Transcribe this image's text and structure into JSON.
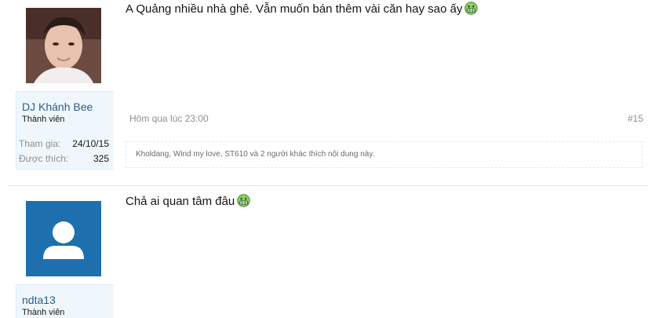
{
  "posts": [
    {
      "username": "DJ Khánh Bee",
      "user_title": "Thành viên",
      "joined_label": "Tham gia:",
      "joined_value": "24/10/15",
      "likes_label": "Được thích:",
      "likes_value": "325",
      "message": "A Quảng nhiều nhà ghê. Vẫn muốn bán thêm vài căn hay sao ấy",
      "date": "Hôm qua lúc 23:00",
      "post_number": "#15",
      "liked_by": "Kholdang, Wind my love, ST610 và 2 người khác thích nội dung này."
    },
    {
      "username": "ndta13",
      "user_title": "Thành viên",
      "message": "Chả ai quan tâm đâu"
    }
  ],
  "colors": {
    "link": "#2b5d8c",
    "muted": "#8f8f8f",
    "border": "#d7edfc",
    "user_panel": "#f0f7fc",
    "default_avatar_bg": "#1e6fad"
  },
  "icons": [
    "grin-emoji-icon",
    "default-avatar-icon"
  ]
}
